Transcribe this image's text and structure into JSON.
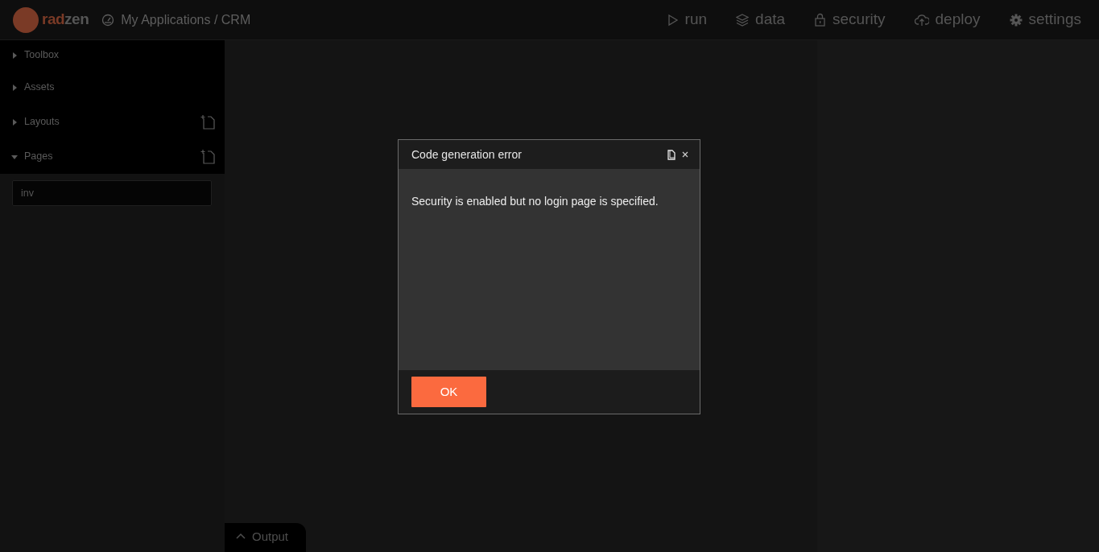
{
  "header": {
    "logo": {
      "parts": [
        "rad",
        "zen"
      ]
    },
    "breadcrumb": "My Applications / CRM",
    "nav": [
      {
        "kind": "run",
        "label": "run"
      },
      {
        "kind": "data",
        "label": "data"
      },
      {
        "kind": "security",
        "label": "security"
      },
      {
        "kind": "deploy",
        "label": "deploy"
      },
      {
        "kind": "settings",
        "label": "settings"
      }
    ]
  },
  "sidebar": {
    "sections": [
      {
        "label": "Toolbox",
        "expanded": false,
        "can_add": false
      },
      {
        "label": "Assets",
        "expanded": false,
        "can_add": false
      },
      {
        "label": "Layouts",
        "expanded": false,
        "can_add": true
      },
      {
        "label": "Pages",
        "expanded": true,
        "can_add": true
      }
    ],
    "pages": [
      "inv"
    ]
  },
  "output_panel": {
    "label": "Output",
    "expanded": false
  },
  "dialog": {
    "title": "Code generation error",
    "message": "Security is enabled but no login page is specified.",
    "button": "OK"
  }
}
